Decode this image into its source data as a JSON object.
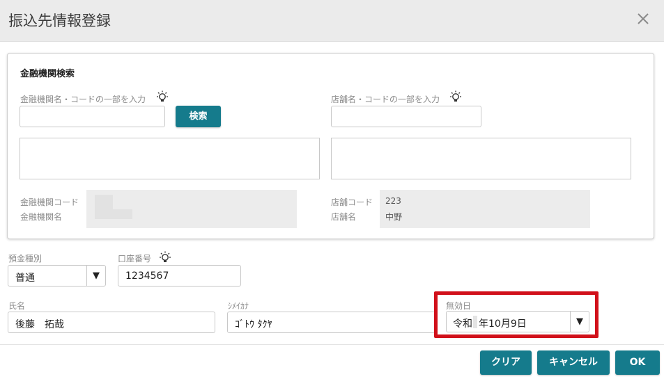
{
  "dialog": {
    "title": "振込先情報登録"
  },
  "bank_search": {
    "section_title": "金融機関検索",
    "bank_query_label": "金融機関名・コードの一部を入力",
    "bank_query_value": "",
    "search_button": "検索",
    "branch_query_label": "店舗名・コードの一部を入力",
    "branch_query_value": "",
    "bank_code_label": "金融機関コード",
    "bank_name_label": "金融機関名",
    "branch_code_label": "店舗コード",
    "branch_code_value": "223",
    "branch_name_label": "店舗名",
    "branch_name_value": "中野"
  },
  "account": {
    "deposit_type_label": "預金種別",
    "deposit_type_value": "普通",
    "account_number_label": "口座番号",
    "account_number_value": "1234567",
    "name_label": "氏名",
    "name_value": "後藤　拓哉",
    "kana_label": "ｼﾒｲｶﾅ",
    "kana_value": "ｺﾞﾄｳ ﾀｸﾔ",
    "invalid_date_label": "無効日",
    "invalid_date_era": "令和",
    "invalid_date_rest": "年10月9日"
  },
  "footer": {
    "clear_button": "クリア",
    "cancel_button": "キャンセル",
    "ok_button": "OK"
  },
  "icons": {
    "close": "close-icon",
    "bulb": "lightbulb-icon",
    "dropdown": "chevron-down-icon"
  },
  "colors": {
    "primary_button": "#157b8c",
    "highlight": "#d1101a",
    "titlebar": "#ebebeb"
  }
}
